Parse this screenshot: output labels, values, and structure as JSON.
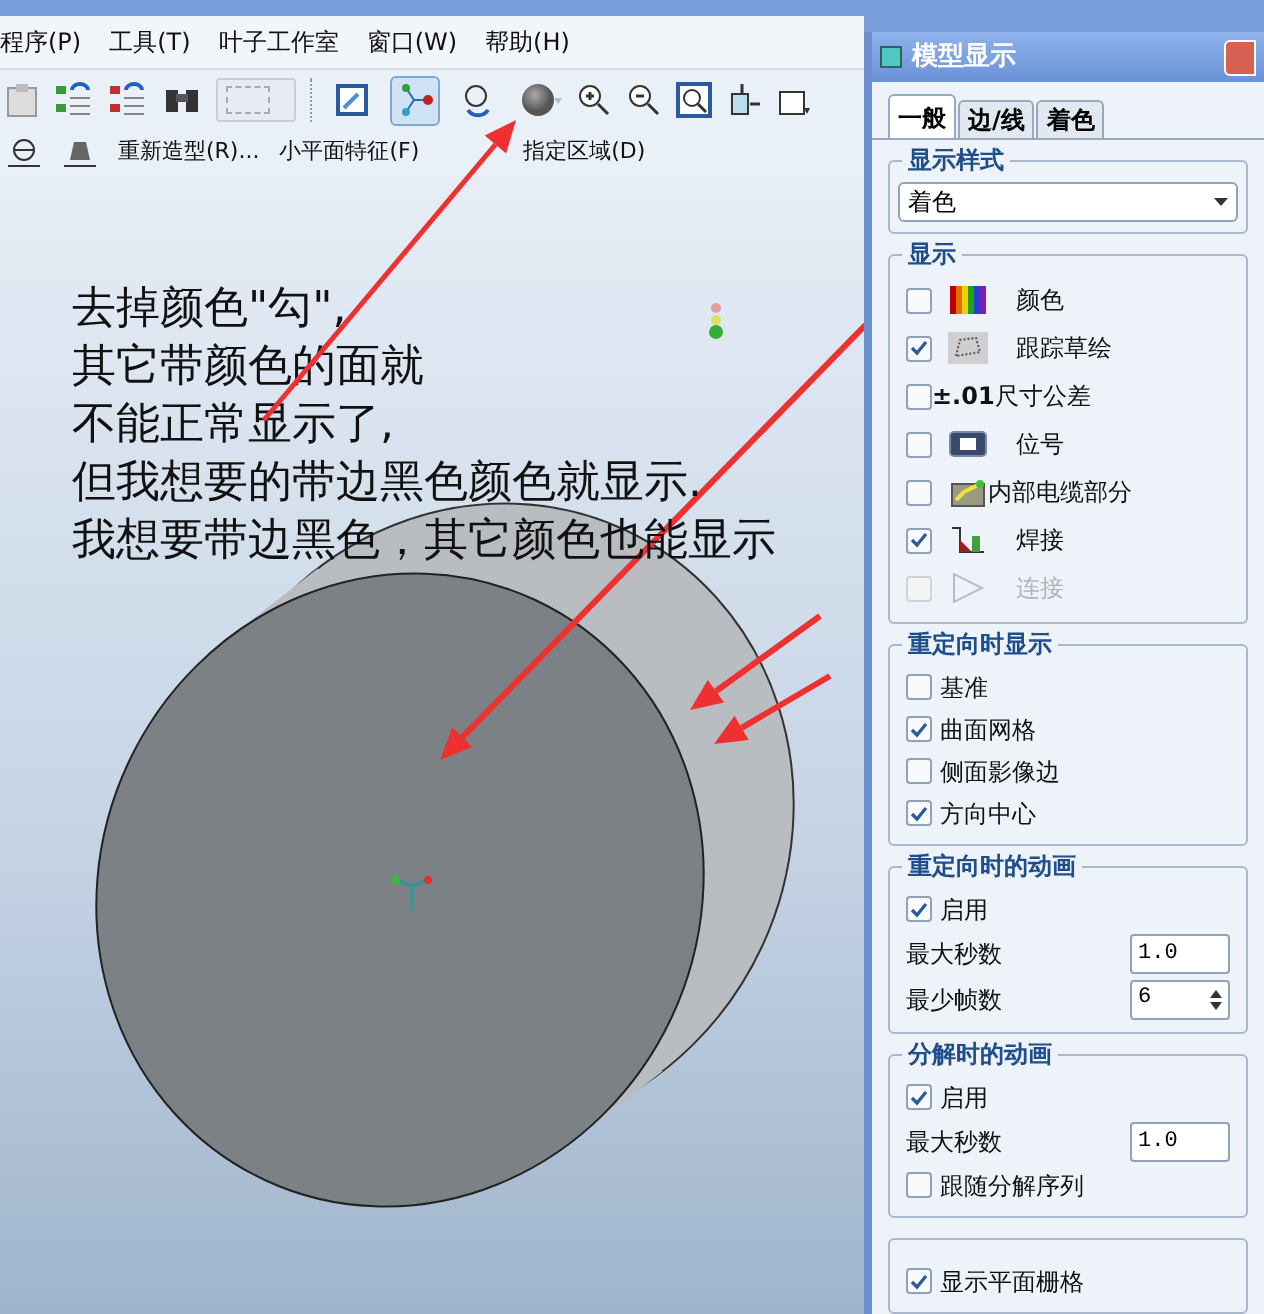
{
  "menu": [
    "程序(P)",
    "工具(T)",
    "叶子工作室",
    "窗口(W)",
    "帮助(H)"
  ],
  "view_toolbar": [
    {
      "kind": "sketch",
      "pressed": false
    },
    {
      "kind": "nodes",
      "pressed": true
    },
    {
      "kind": "spin",
      "pressed": false
    }
  ],
  "feature_toolbar": [
    "重新造型(R)...",
    "小平面特征(F)",
    "指定区域(D)"
  ],
  "annotation": [
    "去掉颜色\"勾\",",
    "其它带颜色的面就",
    "不能正常显示了,",
    "但我想要的带边黑色颜色就显示.",
    "我想要带边黑色，其它颜色也能显示"
  ],
  "dialog": {
    "title": "模型显示",
    "tabs": [
      {
        "label": "一般",
        "selected": true
      },
      {
        "label": "边/线",
        "selected": false
      },
      {
        "label": "着色",
        "selected": false
      }
    ],
    "display_style": {
      "legend": "显示样式",
      "value": "着色"
    },
    "display": {
      "legend": "显示",
      "items": [
        {
          "label": "颜色",
          "kind": "color",
          "checked": false,
          "disabled": false
        },
        {
          "label": "跟踪草绘",
          "kind": "sketch",
          "checked": true,
          "disabled": false
        },
        {
          "label": "**±.01**尺寸公差",
          "kind": "none",
          "checked": false,
          "disabled": false
        },
        {
          "label": "位号",
          "kind": "balloon",
          "checked": false,
          "disabled": false
        },
        {
          "label": "内部电缆部分",
          "kind": "cable",
          "checked": false,
          "disabled": false
        },
        {
          "label": "焊接",
          "kind": "weld",
          "checked": true,
          "disabled": false
        },
        {
          "label": "连接",
          "kind": "connection",
          "checked": false,
          "disabled": true
        }
      ]
    },
    "reorient_display": {
      "legend": "重定向时显示",
      "items": [
        {
          "label": "基准",
          "checked": false
        },
        {
          "label": "曲面网格",
          "checked": true
        },
        {
          "label": "侧面影像边",
          "checked": false
        },
        {
          "label": "方向中心",
          "checked": true
        }
      ]
    },
    "reorient_animation": {
      "legend": "重定向时的动画",
      "enable": {
        "label": "启用",
        "checked": true
      },
      "fields": [
        {
          "label": "最大秒数",
          "value": "1.0",
          "kind": "text"
        },
        {
          "label": "最少帧数",
          "value": "6",
          "kind": "spinner"
        }
      ]
    },
    "explode_animation": {
      "legend": "分解时的动画",
      "enable": {
        "label": "启用",
        "checked": true
      },
      "fields": [
        {
          "label": "最大秒数",
          "value": "1.0",
          "kind": "text"
        }
      ],
      "follow": {
        "label": "跟随分解序列",
        "checked": false
      }
    },
    "grid": {
      "items": [
        {
          "label": "显示平面栅格",
          "checked": true
        }
      ]
    }
  }
}
